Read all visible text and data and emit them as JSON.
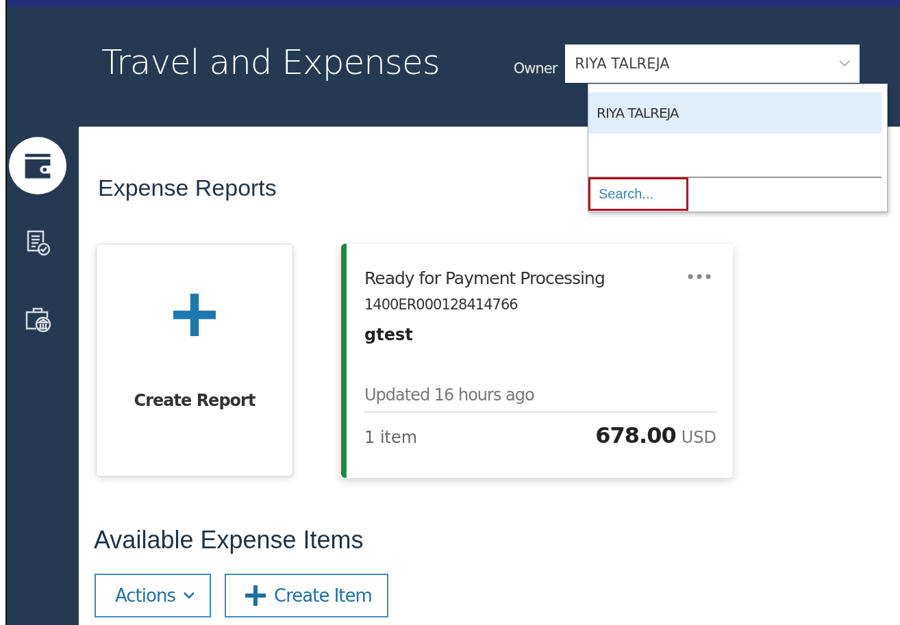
{
  "header": {
    "title": "Travel and Expenses",
    "owner_label": "Owner",
    "owner_value": "RIYA TALREJA"
  },
  "owner_dropdown": {
    "options": [
      {
        "label": "RIYA TALREJA",
        "selected": true
      }
    ],
    "search_link": {
      "label": "Search...",
      "highlighted": true
    }
  },
  "nav": [
    {
      "kind": "wallet",
      "selected": true
    },
    {
      "kind": "report-check",
      "selected": false
    },
    {
      "kind": "briefcase-bank",
      "selected": false
    }
  ],
  "expense_reports": {
    "heading": "Expense Reports",
    "create_card": {
      "label": "Create Report"
    },
    "reports": [
      {
        "status": "Ready for Payment Processing",
        "id": "1400ER000128414766",
        "name": "gtest",
        "updated": "Updated 16 hours ago",
        "items": "1 item",
        "amount": "678.00",
        "currency": "USD",
        "color": "#1e8a3c"
      }
    ]
  },
  "expense_items": {
    "heading": "Available Expense Items",
    "buttons": [
      {
        "kind": "menu",
        "label": "Actions"
      },
      {
        "kind": "create",
        "label": "Create Item"
      }
    ]
  }
}
